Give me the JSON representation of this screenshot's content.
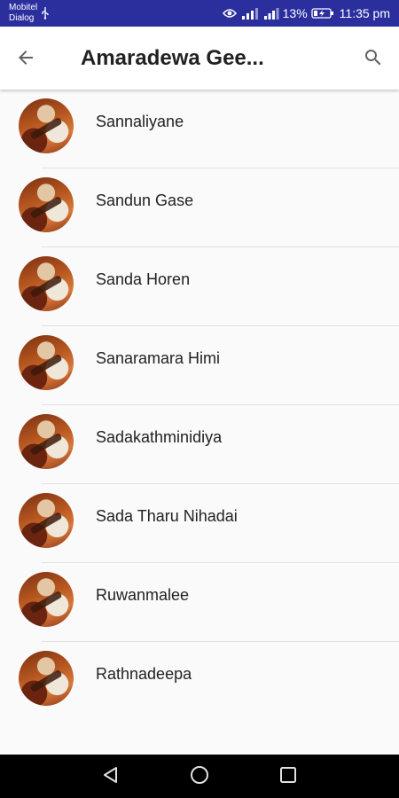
{
  "status_bar": {
    "carrier1": "Mobitel",
    "carrier2": "Dialog",
    "battery_percent": "13%",
    "time": "11:35 pm",
    "icons": [
      "usb-icon",
      "eye-icon",
      "signal-icon",
      "signal-icon",
      "battery-charging-icon"
    ]
  },
  "app_bar": {
    "title": "Amaradewa Gee...",
    "back_icon": "arrow-back-icon",
    "search_icon": "search-icon",
    "background": "#ffffff"
  },
  "songs": [
    {
      "title": "Sannaliyane"
    },
    {
      "title": "Sandun Gase"
    },
    {
      "title": "Sanda Horen"
    },
    {
      "title": "Sanaramara Himi"
    },
    {
      "title": "Sadakathminidiya"
    },
    {
      "title": "Sada Tharu Nihadai"
    },
    {
      "title": "Ruwanmalee"
    },
    {
      "title": "Rathnadeepa"
    }
  ],
  "nav_bar": {
    "icons": [
      "nav-back-icon",
      "nav-home-icon",
      "nav-recents-icon"
    ]
  },
  "colors": {
    "status_bar": "#2b2f9e",
    "list_background": "#fafafa",
    "nav_bar": "#000000"
  }
}
